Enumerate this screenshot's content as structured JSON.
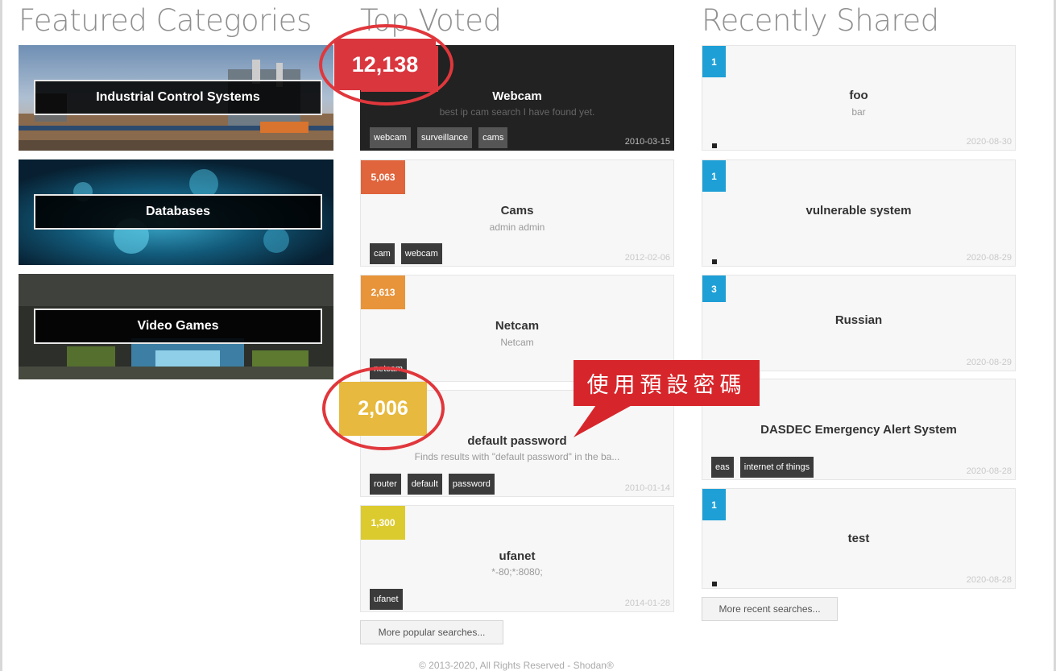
{
  "columns": {
    "featured_title": "Featured Categories",
    "top_voted_title": "Top Voted",
    "recent_title": "Recently Shared"
  },
  "categories": [
    {
      "label": "Industrial Control Systems"
    },
    {
      "label": "Databases"
    },
    {
      "label": "Video Games"
    }
  ],
  "top_voted": [
    {
      "count": "12,138",
      "title": "Webcam",
      "subtitle": "best ip cam search I have found yet.",
      "tags": [
        "webcam",
        "surveillance",
        "cams"
      ],
      "date": "2010-03-15"
    },
    {
      "count": "5,063",
      "title": "Cams",
      "subtitle": "admin admin",
      "tags": [
        "cam",
        "webcam"
      ],
      "date": "2012-02-06"
    },
    {
      "count": "2,613",
      "title": "Netcam",
      "subtitle": "Netcam",
      "tags": [
        "netcam"
      ],
      "date": ""
    },
    {
      "count": "2,006",
      "title": "default password",
      "subtitle": "Finds results with \"default password\" in the ba...",
      "tags": [
        "router",
        "default",
        "password"
      ],
      "date": "2010-01-14"
    },
    {
      "count": "1,300",
      "title": "ufanet",
      "subtitle": "*-80;*:8080;",
      "tags": [
        "ufanet"
      ],
      "date": "2014-01-28"
    }
  ],
  "recent": [
    {
      "count": "1",
      "title": "foo",
      "subtitle": "bar",
      "tags": [],
      "date": "2020-08-30"
    },
    {
      "count": "1",
      "title": "vulnerable system",
      "subtitle": "",
      "tags": [],
      "date": "2020-08-29"
    },
    {
      "count": "3",
      "title": "Russian",
      "subtitle": "",
      "tags": [],
      "date": "2020-08-29"
    },
    {
      "count": "",
      "title": "DASDEC Emergency Alert System",
      "subtitle": "",
      "tags": [
        "eas",
        "internet of things"
      ],
      "date": "2020-08-28"
    },
    {
      "count": "1",
      "title": "test",
      "subtitle": "",
      "tags": [],
      "date": "2020-08-28"
    }
  ],
  "buttons": {
    "more_popular": "More popular searches...",
    "more_recent": "More recent searches..."
  },
  "footer": "© 2013-2020, All Rights Reserved - Shodan®",
  "annotation": {
    "callout_text": "使用預設密碼"
  },
  "colors": {
    "count_top1": "#d9363e",
    "count_top2": "#e0643c",
    "count_top3": "#e8943a",
    "count_top4": "#e7b93e",
    "count_top5": "#dccb2f",
    "count_recent": "#1e9fd6",
    "annotation_red": "#d7262b"
  }
}
